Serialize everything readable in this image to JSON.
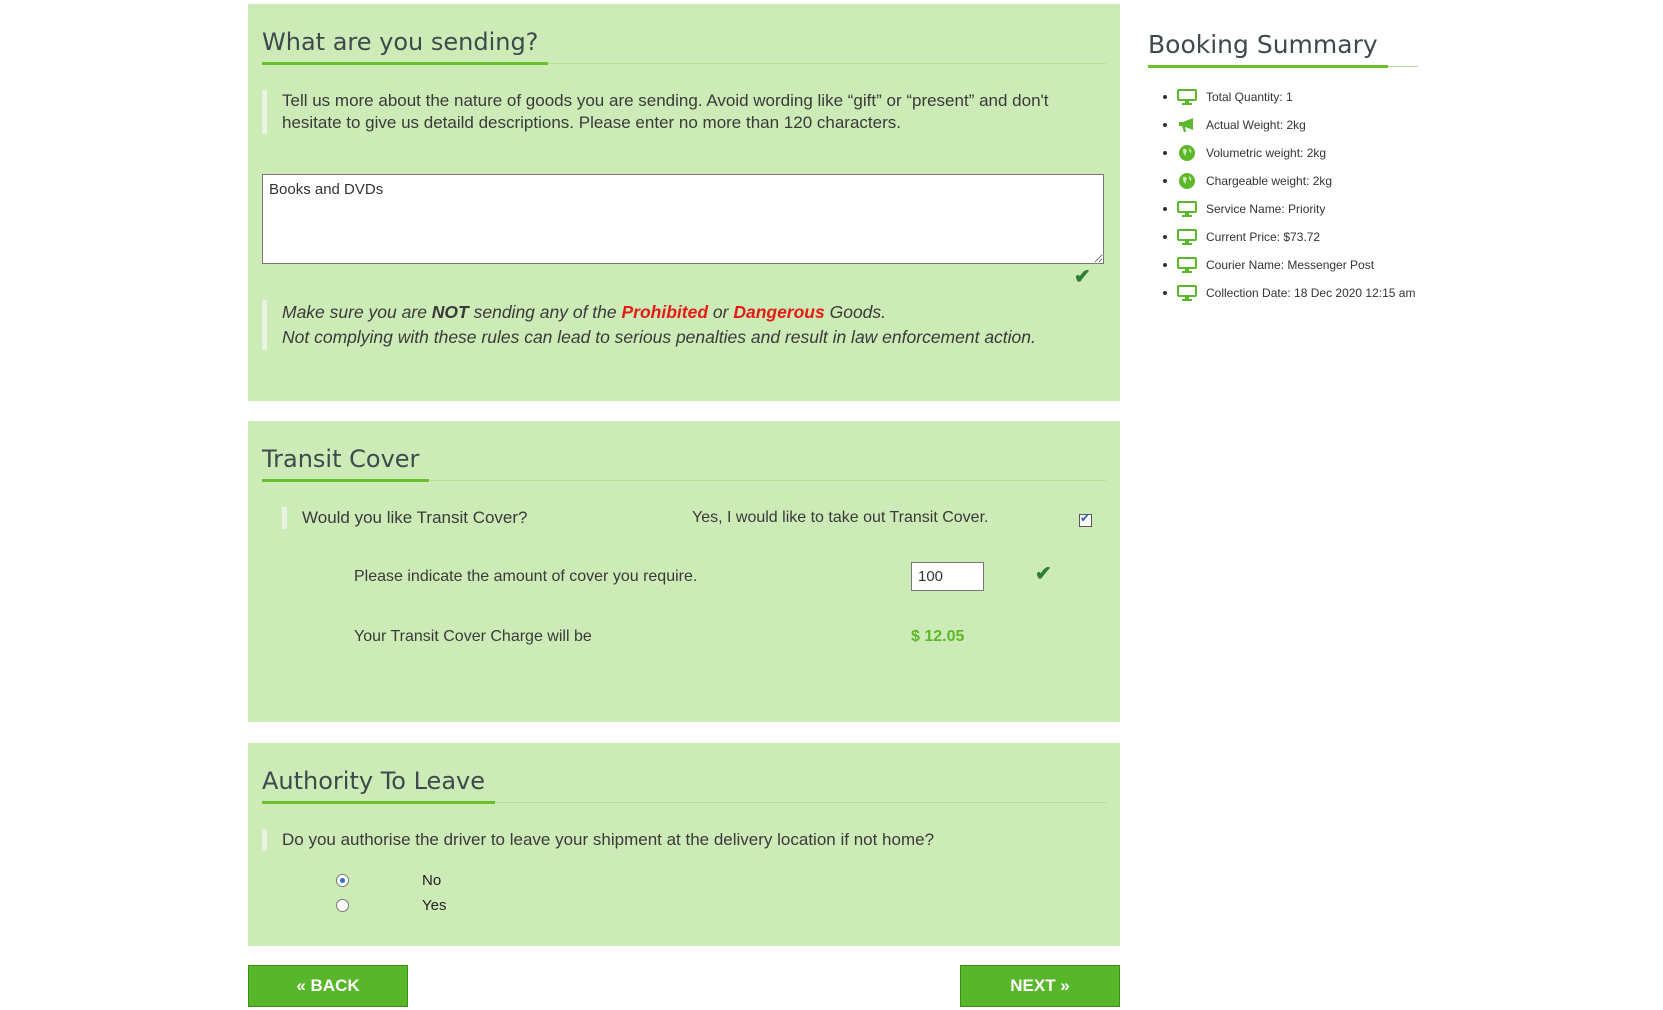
{
  "goods": {
    "heading": "What are you sending?",
    "instructions": "Tell us more about the nature of goods you are sending. Avoid wording like “gift” or “present” and don't hesitate to give us detaild descriptions. Please enter no more than 120 characters.",
    "description_value": "Books and DVDs",
    "warning": {
      "part1": "Make sure you are ",
      "not": "NOT",
      "part2": " sending any of the ",
      "prohibited": "Prohibited",
      "or": " or ",
      "dangerous": "Dangerous",
      "part3": " Goods.",
      "line2": "Not complying with these rules can lead to serious penalties and result in law enforcement action."
    }
  },
  "transit": {
    "heading": "Transit Cover",
    "question": "Would you like Transit Cover?",
    "option_label": "Yes, I would like to take out Transit Cover.",
    "option_checked": true,
    "amount_label": "Please indicate the amount of cover you require.",
    "amount_value": "100",
    "charge_label": "Your Transit Cover Charge will be",
    "charge_value": "$ 12.05"
  },
  "authority": {
    "heading": "Authority To Leave",
    "question": "Do you authorise the driver to leave your shipment at the delivery location if not home?",
    "options": [
      {
        "label": "No",
        "selected": true
      },
      {
        "label": "Yes",
        "selected": false
      }
    ]
  },
  "nav": {
    "back_label": "« BACK",
    "next_label": "NEXT »"
  },
  "summary": {
    "heading": "Booking Summary",
    "items": [
      {
        "icon": "monitor-icon",
        "text": "Total Quantity: 1"
      },
      {
        "icon": "megaphone-icon",
        "text": "Actual Weight: 2kg"
      },
      {
        "icon": "globe-icon",
        "text": "Volumetric weight: 2kg"
      },
      {
        "icon": "globe-icon",
        "text": "Chargeable weight: 2kg"
      },
      {
        "icon": "monitor-icon",
        "text": "Service Name: Priority"
      },
      {
        "icon": "monitor-icon",
        "text": "Current Price: $73.72"
      },
      {
        "icon": "monitor-icon",
        "text": "Courier Name: Messenger Post"
      },
      {
        "icon": "monitor-icon",
        "text": "Collection Date: 18 Dec 2020 12:15 am"
      }
    ]
  },
  "colors": {
    "panel_bg": "#cdebb6",
    "accent_green": "#5cb82a",
    "warning_red": "#e41b17"
  }
}
